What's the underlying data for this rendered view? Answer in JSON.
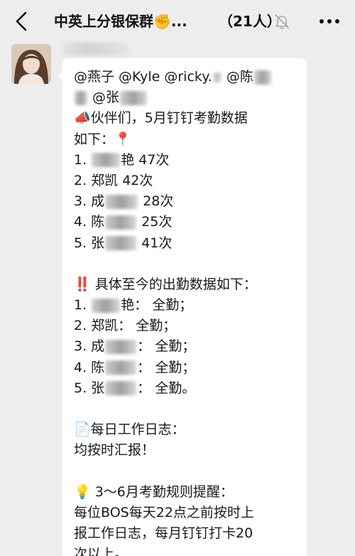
{
  "navbar": {
    "title": "中英上分银保群",
    "title_emoji": "✊",
    "ellipsis": "...",
    "member_count": "（21人）"
  },
  "message": {
    "lines": [
      {
        "before": "@燕子 @Kyle @ricky.",
        "after": " @陈"
      },
      {
        "before": "",
        "after": " @张"
      },
      {
        "emoji": "📣",
        "text": "伙伴们，5月钉钉考勤数据"
      },
      {
        "text": "如下：",
        "emoji_after": "📍"
      },
      {
        "prefix": "1. ",
        "text": "艳 47次"
      },
      {
        "prefix": "2. ",
        "text": "郑凯 42次"
      },
      {
        "prefix": "3. 成",
        "text": " 28次"
      },
      {
        "prefix": "4. 陈",
        "text": " 25次"
      },
      {
        "prefix": "5. 张",
        "text": " 41次"
      },
      {
        "emoji": "‼️",
        "text": " 具体至今的出勤数据如下："
      },
      {
        "prefix": "1. ",
        "text": "艳：  全勤；"
      },
      {
        "prefix": "2. ",
        "text": "郑凯：  全勤；"
      },
      {
        "prefix": "3. 成",
        "text": "：  全勤；"
      },
      {
        "prefix": "4. 陈",
        "text": "：  全勤；"
      },
      {
        "prefix": "5. 张",
        "text": "：  全勤。"
      },
      {
        "emoji": "📄",
        "text": "每日工作日志："
      },
      {
        "text": "均按时汇报！"
      },
      {
        "emoji": "💡",
        "text": " 3～6月考勤规则提醒："
      },
      {
        "text": "每位BOS每天22点之前按时上"
      },
      {
        "text": "报工作日志，每月钉钉打卡20"
      },
      {
        "text": "次以上。"
      }
    ]
  },
  "icons": {
    "back": "chevron-left-icon",
    "mute": "bell-slash-icon",
    "more": "more-dots-icon"
  }
}
